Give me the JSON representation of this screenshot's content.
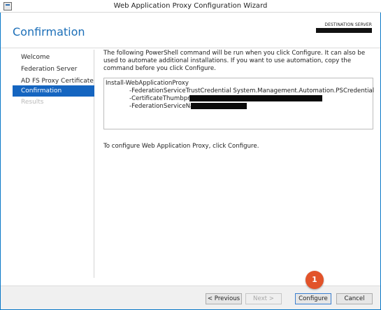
{
  "window": {
    "title": "Web Application Proxy Configuration Wizard"
  },
  "header": {
    "page_title": "Confirmation",
    "destination_label": "DESTINATION SERVER"
  },
  "nav": {
    "items": [
      {
        "label": "Welcome",
        "state": "normal"
      },
      {
        "label": "Federation Server",
        "state": "normal"
      },
      {
        "label": "AD FS Proxy Certificate",
        "state": "normal"
      },
      {
        "label": "Confirmation",
        "state": "active"
      },
      {
        "label": "Results",
        "state": "disabled"
      }
    ]
  },
  "content": {
    "intro": "The following PowerShell command will be run when you click Configure. It can also be used to automate additional installations. If you want to use automation, copy the command before you click Configure.",
    "command": {
      "line1": "Install-WebApplicationProxy",
      "line2": "-FederationServiceTrustCredential System.Management.Automation.PSCredential",
      "line3": "-CertificateThumbprint '",
      "line4": "-FederationServiceName '"
    },
    "footer": "To configure Web Application Proxy, click Configure."
  },
  "buttons": {
    "previous": "< Previous",
    "next": "Next >",
    "configure": "Configure",
    "cancel": "Cancel"
  },
  "annotation": {
    "step": "1"
  },
  "colors": {
    "accent": "#1565c0",
    "title_blue": "#1c6fb8",
    "marker": "#e2532a"
  }
}
